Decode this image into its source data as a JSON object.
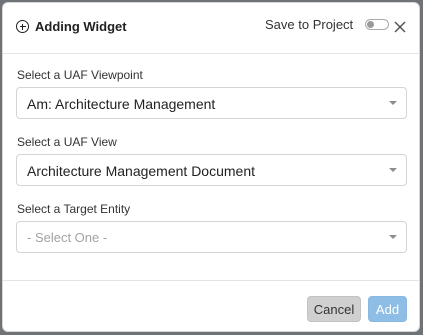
{
  "dialog": {
    "title": "Adding Widget",
    "save_to_project_label": "Save to Project",
    "save_to_project_enabled": false
  },
  "fields": [
    {
      "label": "Select a UAF Viewpoint",
      "value": "Am: Architecture Management",
      "is_placeholder": false
    },
    {
      "label": "Select a UAF View",
      "value": "Architecture Management Document",
      "is_placeholder": false
    },
    {
      "label": "Select a Target Entity",
      "value": "- Select One -",
      "is_placeholder": true
    }
  ],
  "footer": {
    "cancel_label": "Cancel",
    "add_label": "Add"
  },
  "colors": {
    "add_button": "#8ebee6",
    "cancel_button": "#d0d0d0",
    "placeholder_text": "#a3a3a3"
  },
  "icons": {
    "title_icon": "plus-circle-icon",
    "close_icon": "close-icon",
    "dropdown_icon": "caret-down-icon"
  }
}
